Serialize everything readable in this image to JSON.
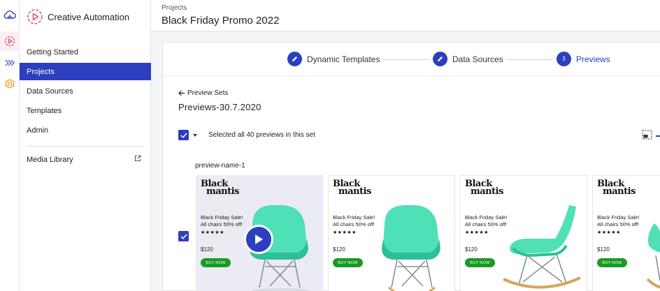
{
  "app": {
    "name": "Creative Automation"
  },
  "nav": {
    "items": [
      {
        "label": "Getting Started"
      },
      {
        "label": "Projects"
      },
      {
        "label": "Data Sources"
      },
      {
        "label": "Templates"
      },
      {
        "label": "Admin"
      }
    ],
    "media_library": "Media Library"
  },
  "header": {
    "breadcrumb": "Projects",
    "title": "Black Friday Promo 2022"
  },
  "stepper": {
    "steps": [
      {
        "label": "Dynamic Templates"
      },
      {
        "label": "Data Sources"
      },
      {
        "label": "Previews",
        "number": "3"
      }
    ]
  },
  "preview_set": {
    "back_label": "Preview Sets",
    "title": "Previews-30.7.2020",
    "selection_text": "Selected all 40 previews in this set",
    "row_name": "preview-name-1"
  },
  "tile": {
    "logo_line1": "Black",
    "logo_line2": "mantis",
    "promo_line1": "Black Friday Sale!",
    "promo_line2": "All chairs 50% off!",
    "stars": "★★★★★",
    "price": "$120",
    "buy_label": "BUY NOW"
  },
  "colors": {
    "accent": "#2c3fbf",
    "chair": "#4fe0b7",
    "buy": "#1a9b25"
  }
}
